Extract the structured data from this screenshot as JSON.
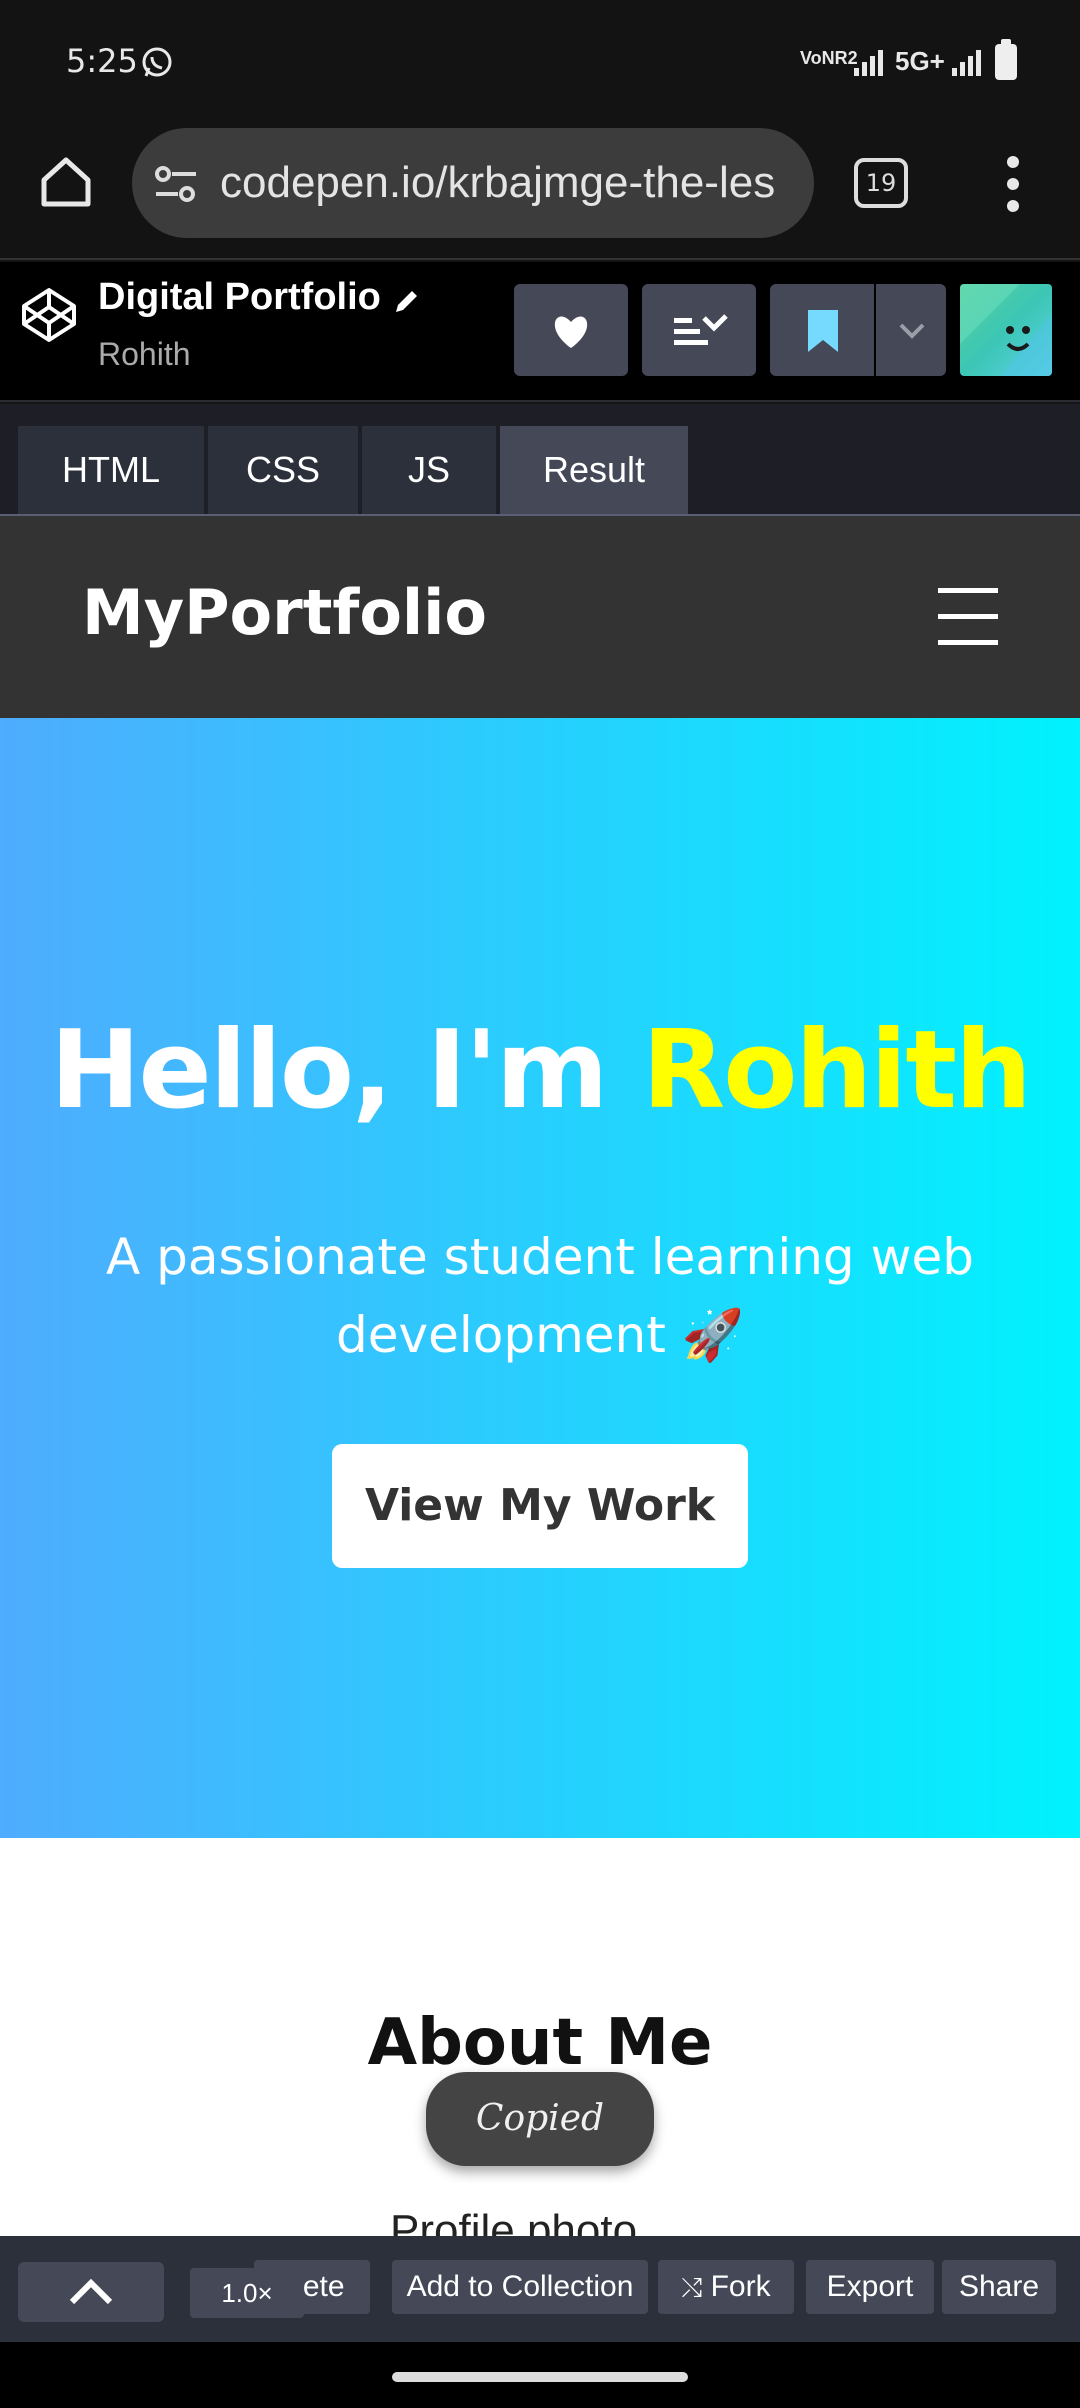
{
  "status": {
    "time": "5:25",
    "network_label": "VoNR2",
    "network_type": "5G+",
    "icons": [
      "whatsapp-icon",
      "signal-icon",
      "signal-icon",
      "battery-icon"
    ]
  },
  "browser": {
    "url": "codepen.io/krbajmge-the-les",
    "tab_count": "19",
    "icons": [
      "home-icon",
      "site-settings-icon",
      "more-icon"
    ]
  },
  "pen": {
    "title": "Digital Portfolio",
    "author": "Rohith",
    "icons": [
      "codepen-logo-icon",
      "edit-pencil-icon",
      "heart-icon",
      "layout-icon",
      "bookmark-icon",
      "chevron-down-icon"
    ]
  },
  "editor_tabs": [
    {
      "label": "HTML"
    },
    {
      "label": "CSS"
    },
    {
      "label": "JS"
    },
    {
      "label": "Result",
      "active": true
    }
  ],
  "site": {
    "logo": "MyPortfolio",
    "hero_greeting": "Hello, I'm",
    "hero_name": "Rohith",
    "hero_subtitle": "A passionate student learning web development 🚀",
    "hero_button": "View My Work",
    "about_title": "About Me",
    "about_peek": "Profile photo",
    "colors": {
      "nav_bg": "#333333",
      "hero_start": "#4facfe",
      "hero_end": "#00f2fe",
      "name_accent": "#ffff00"
    }
  },
  "toast": {
    "text": "Copied"
  },
  "toolbar": {
    "zoom": "1.0×",
    "delete_label": "elete",
    "add_to_collection_label": "Add to Collection",
    "fork_label": "Fork",
    "export_label": "Export",
    "share_label": "Share"
  }
}
